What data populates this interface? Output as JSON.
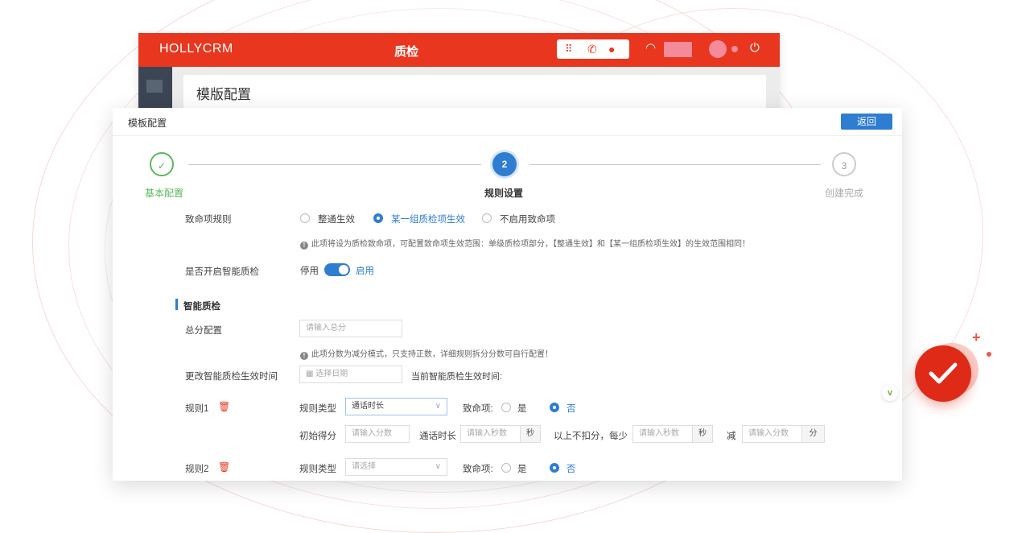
{
  "back_window": {
    "brand": "HOLLYCRM",
    "title": "质检",
    "page_heading": "模版配置"
  },
  "panel": {
    "title": "模板配置",
    "back_button": "返回"
  },
  "steps": [
    {
      "index": "✓",
      "label": "基本配置",
      "status": "done"
    },
    {
      "index": "2",
      "label": "规则设置",
      "status": "active"
    },
    {
      "index": "3",
      "label": "创建完成",
      "status": "pending"
    }
  ],
  "fatal_rule": {
    "label": "致命项规则",
    "options": [
      "整通生效",
      "某一组质检项生效",
      "不启用致命项"
    ],
    "selected": "某一组质检项生效",
    "note": "此项将设为质检致命项，可配置致命项生效范围：单级质检项部分，【整通生效】和【某一组质检项生效】的生效范围相同！"
  },
  "smart_qc_toggle": {
    "label": "是否开启智能质检",
    "off_label": "停用",
    "on_label": "启用",
    "enabled": true
  },
  "section_title": "智能质检",
  "total_score": {
    "label": "总分配置",
    "placeholder": "请输入总分",
    "note": "此项分数为减分模式，只支持正数，详细规则拆分分数可自行配置！"
  },
  "effective_time": {
    "label": "更改智能质检生效时间",
    "placeholder": "选择日期",
    "current_label": "当前智能质检生效时间:"
  },
  "rules": [
    {
      "name": "规则1",
      "type_label": "规则类型",
      "type_value": "通话时长",
      "fatal_label": "致命项:",
      "yes": "是",
      "no": "否",
      "fatal_selected": "否",
      "initial_score_label": "初始得分",
      "initial_score_placeholder": "请输入分数",
      "call_duration_label": "通话时长",
      "seconds_placeholder": "请输入秒数",
      "seconds_unit": "秒",
      "above_text": "以上不扣分，每少",
      "seconds_placeholder_2": "请输入秒数",
      "seconds_unit_2": "秒",
      "minus_label": "减",
      "points_placeholder": "请输入分数",
      "points_unit": "分"
    },
    {
      "name": "规则2",
      "type_label": "规则类型",
      "type_placeholder": "请选择",
      "fatal_label": "致命项:",
      "yes": "是",
      "no": "否",
      "fatal_selected": "否"
    }
  ],
  "colors": {
    "brand_red": "#e8361f",
    "primary_blue": "#2e7dd1",
    "success_green": "#5cb85c"
  },
  "icons": {
    "topbar": [
      "apps-grid-icon",
      "phone-icon",
      "chat-icon",
      "wifi-icon",
      "status-dot-icon",
      "power-icon"
    ],
    "trash": "trash-icon",
    "calendar": "calendar-icon",
    "check_badge": "check-badge-icon"
  }
}
